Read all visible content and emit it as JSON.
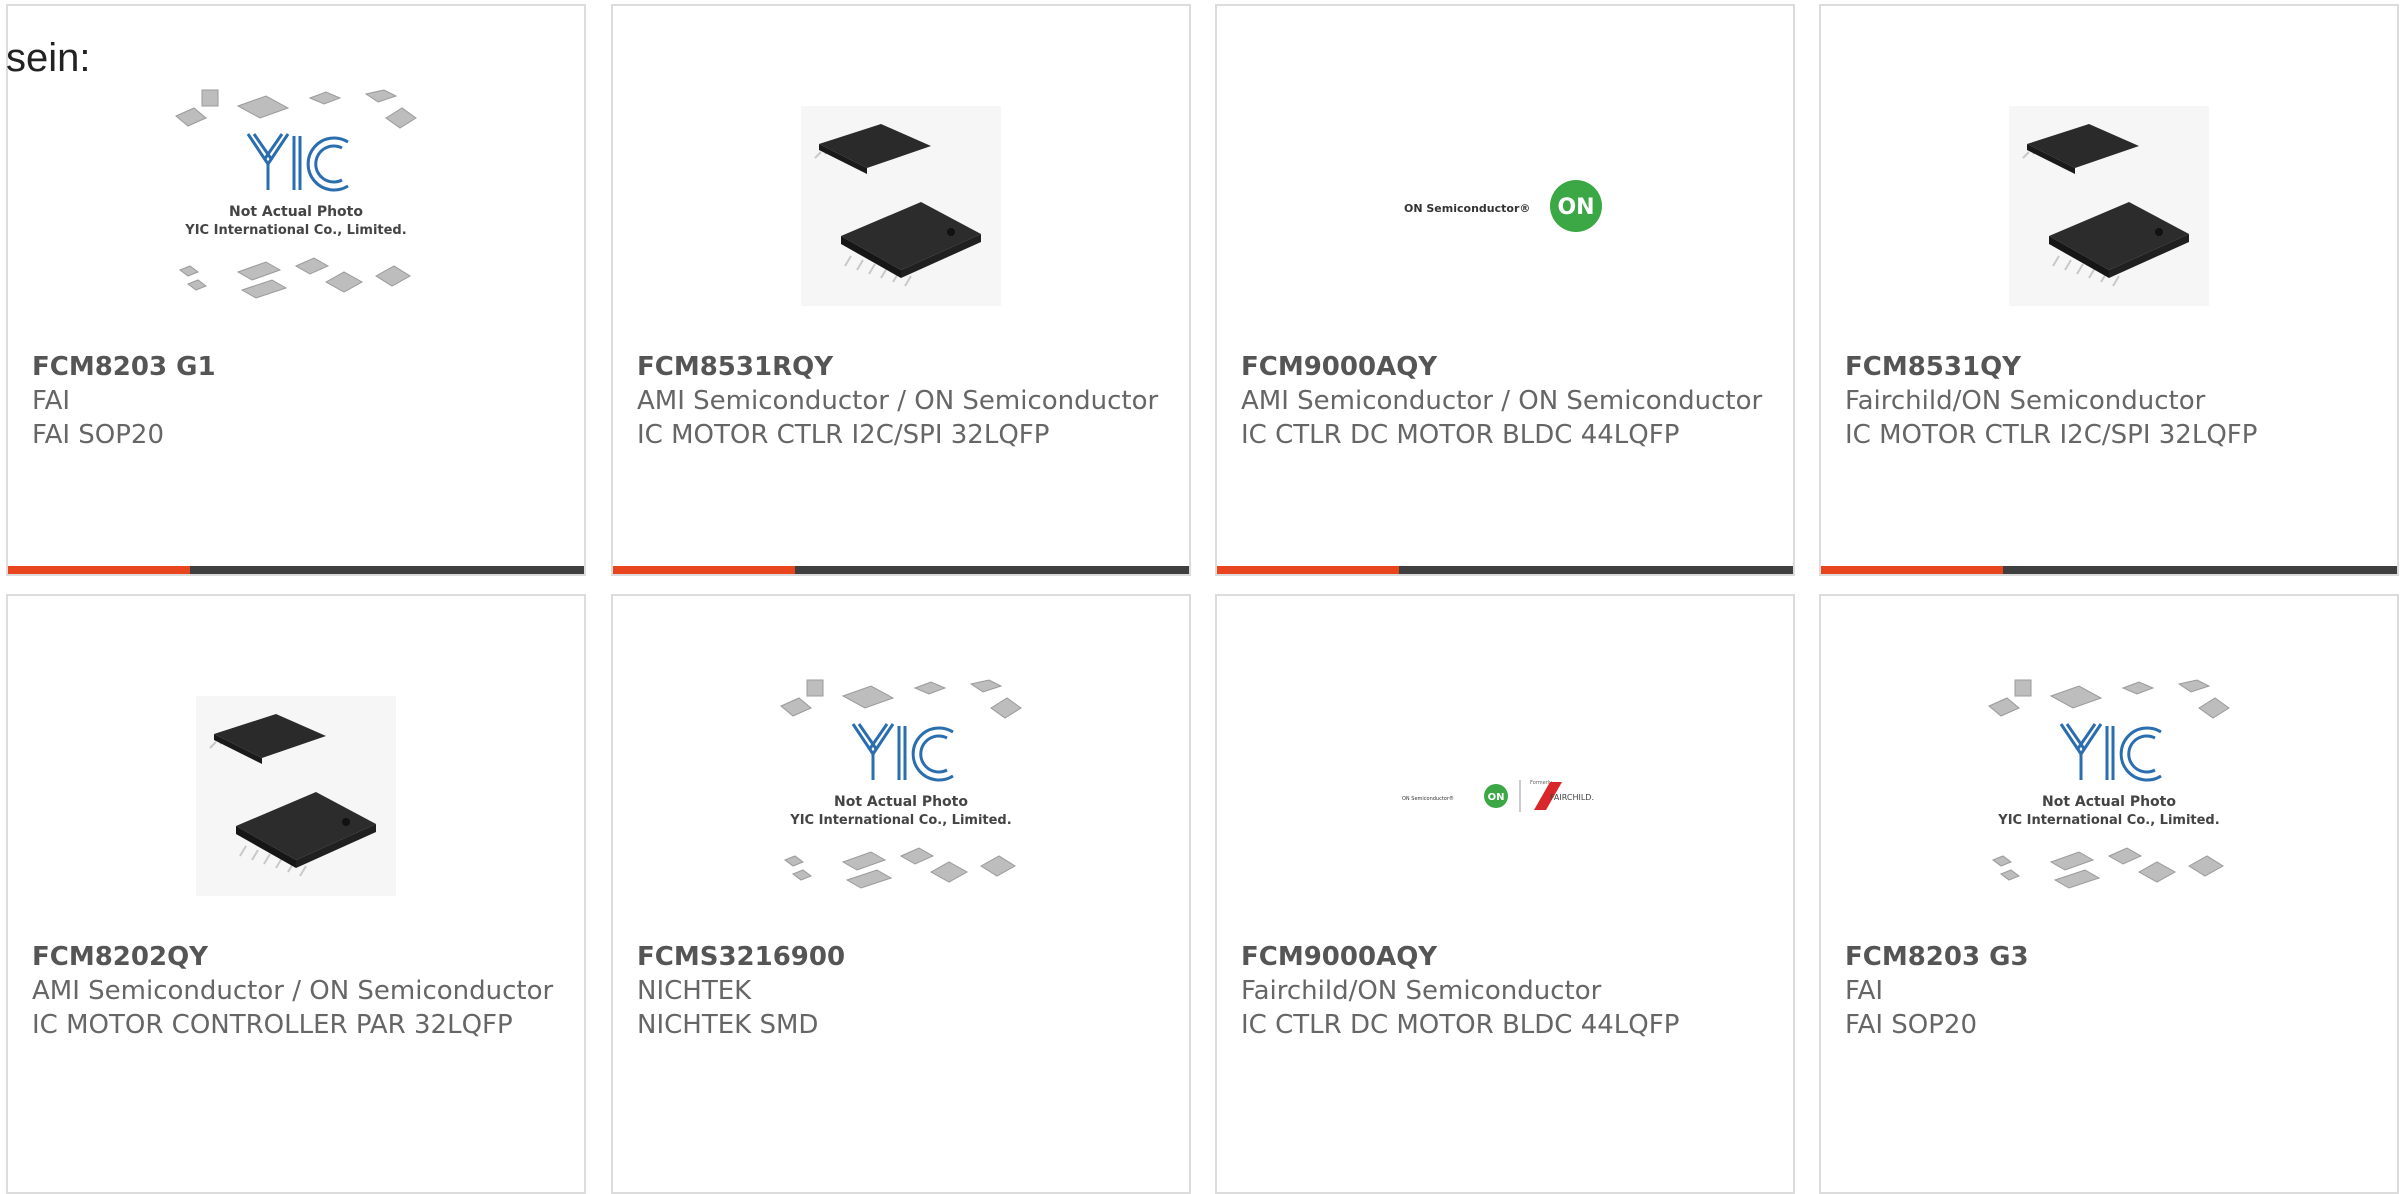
{
  "intro_text": "sein:",
  "accent_color": "#e8451e",
  "placeholder": {
    "line1": "Not Actual Photo",
    "line2": "YIC International Co., Limited."
  },
  "products": [
    {
      "part": "FCM8203 G1",
      "manufacturer": "FAI",
      "description": "FAI SOP20",
      "image": "yic-placeholder"
    },
    {
      "part": "FCM8531RQY",
      "manufacturer": "AMI Semiconductor / ON Semiconductor",
      "description": "IC MOTOR CTLR I2C/SPI 32LQFP",
      "image": "qfp-chip-photo"
    },
    {
      "part": "FCM9000AQY",
      "manufacturer": "AMI Semiconductor / ON Semiconductor",
      "description": "IC CTLR DC MOTOR BLDC 44LQFP",
      "image": "on-semi-logo",
      "logo_text": "ON Semiconductor®",
      "logo_badge": "ON"
    },
    {
      "part": "FCM8531QY",
      "manufacturer": "Fairchild/ON Semiconductor",
      "description": "IC MOTOR CTLR I2C/SPI 32LQFP",
      "image": "qfp-chip-photo"
    },
    {
      "part": "FCM8202QY",
      "manufacturer": "AMI Semiconductor / ON Semiconductor",
      "description": "IC MOTOR CONTROLLER PAR 32LQFP",
      "image": "qfp-chip-photo"
    },
    {
      "part": "FCMS3216900",
      "manufacturer": "NICHTEK",
      "description": "NICHTEK SMD",
      "image": "yic-placeholder"
    },
    {
      "part": "FCM9000AQY",
      "manufacturer": "Fairchild/ON Semiconductor",
      "description": "IC CTLR DC MOTOR BLDC 44LQFP",
      "image": "on-fairchild-logo",
      "logo_text": "ON Semiconductor®",
      "logo_badge": "ON",
      "logo_formerly": "Formerly",
      "logo_fairchild": "FAIRCHILD."
    },
    {
      "part": "FCM8203 G3",
      "manufacturer": "FAI",
      "description": "FAI SOP20",
      "image": "yic-placeholder"
    }
  ]
}
